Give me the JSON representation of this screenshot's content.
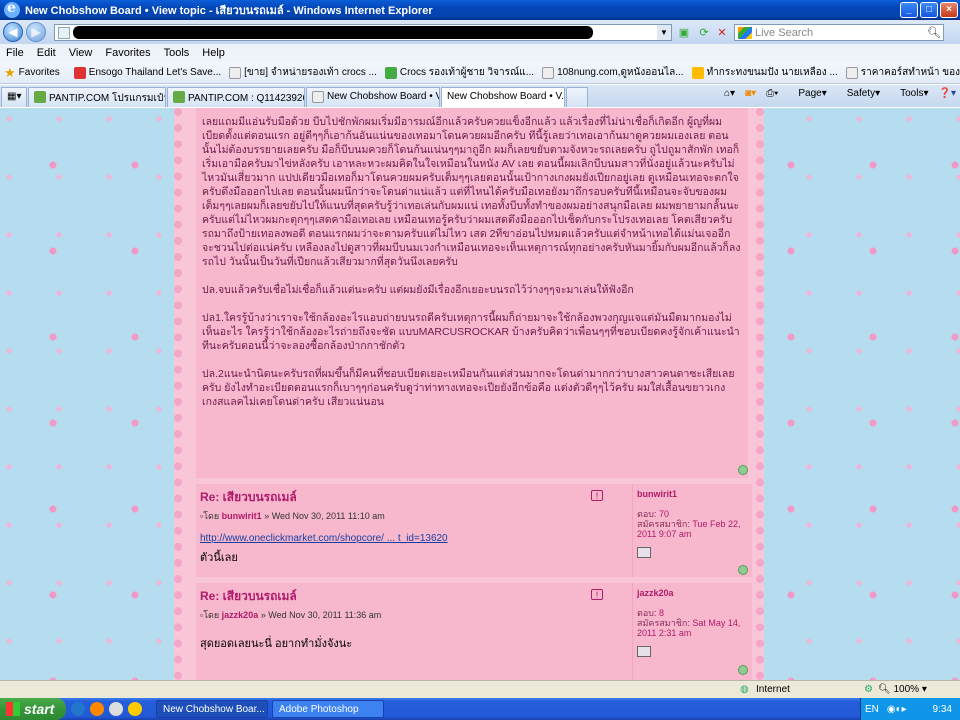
{
  "window": {
    "title": "New Chobshow Board • View topic - เสียวบนรถเมล์ - Windows Internet Explorer"
  },
  "address": {
    "search_placeholder": "Live Search"
  },
  "menu": [
    "File",
    "Edit",
    "View",
    "Favorites",
    "Tools",
    "Help"
  ],
  "favorites": {
    "label": "Favorites",
    "items": [
      "Ensogo Thailand  Let's Save...",
      "[ขาย] จำหน่ายรองเท้า crocs ...",
      "Crocs รองเท้าผู้ชาย วิจารณ์แ...",
      "108nung.com,ดูหนังออนไล...",
      "ทำกระทงขนมปัง นายเหลือง ...",
      "ราคาคอร์สทำหน้า ของคลินิค..."
    ]
  },
  "tabs": [
    "PANTIP.COM โปรแกรมเป๋า : ...",
    "PANTIP.COM : Q11423926 ส...",
    "New Chobshow Board • View...",
    "New Chobshow Board • V..."
  ],
  "commands": [
    "Page",
    "Safety",
    "Tools"
  ],
  "post": {
    "paragraphs": [
      "เลยแถมมีแอ่นรับมือด้วย บีบไปชักพักผมเริ่มมีอารมณ์อีกแล้วครับควยแข็งอีกแล้ว แล้วเรื่องที่ไม่น่าเชื่อก็เกิดอีก ผู้ญที่ผมเบียดตั้งแต่ตอนแรก อยู่ดีๆๆก็เอาก้นอันแน่นของเทอมาโดนควยผมอีกครับ ทีนี้รู้เลยว่าเทอเอาก้นมาดูควยผมเองเลย ตอนนั้นไม่ต้องบรรยายเลยครับ มือก็บีบนมควยก็โดนก้นแน่นๆๆมาถูอีก ผมก็เลยขยับตามจังหวะรถเลยครับ ถูไปถูมาสักพัก เทอก็เริ่มเอามือครับมาไข่หลังครับ เอาหละหวะผมคิดในใจเหมือนในหนัง AV เลย ตอนนี้ผมเลิกบีบนมสาวที่นั่งอยู่แล้วนะครับไม่ไหวมันเสี่ยวมาก แปปเดียวมือเทอก็มาโดนควยผมครับเต็มๆๆเลยตอนนั้นเป้ากางเกงผมยังเปียกอยู่เลย ดูเหมือนเทอจะตกใจครับดึงมือออกไปเลย ตอนนั้นผมนึกว่าจะโดนด่าแน่แล้ว แต่ที่ไหนได้ครับมือเทอยังมาถึกรอบครับทีนี้เหมือนจะจับของผมเต็มๆๆเลยผมก็เลยขยับไปให้แนบที่สุดครับรู้ว่าเทอเล่นกับผมแน่ เทอทั้งบีบทั้งทำของผมอย่างสนุกมือเลย ผมพยายามกลั้นนะครับแต่ไม่ไหวผมกะตุกๆๆเสดคามือเทอเลย เหมือนเทอรู้ครับว่าผมเสดตึงมือออกไปเช็ดกับกระโปรงเทอเลย โคตเสียวครับ รถมาถึงป้ายเทอลงพอดี ตอนแรกผมว่าจะตามครับแต่ไม่ไหว เสด 2ทีขาอ่อนไปหมดแล้วครับแต่จำหน้าเทอได้แม่นเจออีกจะชวนไปต่อแน่ครับ เหลืองลงไปดูสาวที่ผมบีบนมเวงกำเหมือนเทอจะเห็นเหตุการณ์ทุกอย่างครับหันมายิ้มกับผมอีกแล้วก็ลงรถไป วันนั้นเป็นวันที่เปียกแล้วเสียวมากที่สุดวันนึงเลยครับ",
      "ปล.จบแล้วครับเชื่อไม่เชื่อก็แล้วแต่นะครับ แต่ผมยังมีเรื่องอีกเยอะบนรถไว้ว่างๆๆจะมาเล่นให้ฟังอีก",
      "ปล1.ใครรู้บ้างว่าเราจะใช้กล้องอะไรแอบถ่ายบนรถดีครับเหตุการนี้ผมก็ถ่ายมาจะใช้กล้องพวงกุญแจแต่มันมืดมากมองไม่เห็นอะไร ใครรู้ว่าใช้กล้องอะไรถ่ายถึงจะชัด แบบMARCUSROCKAR บ้างครับคิดว่าเพื่อนๆๆที่ชอบเบียดคงรู้จักเค้าแนะนำทีนะครับตอนนี้ว่าจะลองซื้อกล้องป่ากกาชักตัว",
      "ปล.2แนะนำนิดนะครับรถที่ผมขึ้นก็มีคนที่ชอบเบียดเยอะเหมือนกันแต่ส่วนมากจะโดนด่ามากกว่าบางสาวคนดาซะเสียเลยครับ ยังไงทำอะเบียดตอนแรกก็เบาๆๆก่อนครับดูว่าท่าทางเทอจะเปียยังอีกข้อคือ แต่งตัวดีๆๆไว้ครับ ผมใส่เสื้อนขยาวเกงเกงสแลคไม่เคยโดนด่าครับ เสียวแน่นอน"
    ]
  },
  "replies": [
    {
      "title": "Re: เสียวบนรถเมล์",
      "by": "โดย",
      "user": "bunwirit1",
      "date": "» Wed Nov 30, 2011 11:10 am",
      "link": "http://www.oneclickmarket.com/shopcore/ ... t_id=13620",
      "text": "ตัวนี้เลย",
      "profile": {
        "name": "bunwirit1",
        "posts_label": "ตอบ:",
        "posts": "70",
        "joined_label": "สมัครสมาชิก:",
        "joined": "Tue Feb 22, 2011 9:07 am"
      }
    },
    {
      "title": "Re: เสียวบนรถเมล์",
      "by": "โดย",
      "user": "jazzk20a",
      "date": "» Wed Nov 30, 2011 11:36 am",
      "link": "",
      "text": "สุดยอดเลยนะนี่ อยากทำมั่งจังนะ",
      "profile": {
        "name": "jazzk20a",
        "posts_label": "ตอบ:",
        "posts": "8",
        "joined_label": "สมัครสมาชิก:",
        "joined": "Sat May 14, 2011 2:31 am"
      }
    }
  ],
  "status": {
    "zone": "Internet",
    "zoom": "100%"
  },
  "taskbar": {
    "start": "start",
    "tasks": [
      "New Chobshow Boar...",
      "Adobe Photoshop"
    ],
    "lang": "EN",
    "clock": "9:34"
  }
}
